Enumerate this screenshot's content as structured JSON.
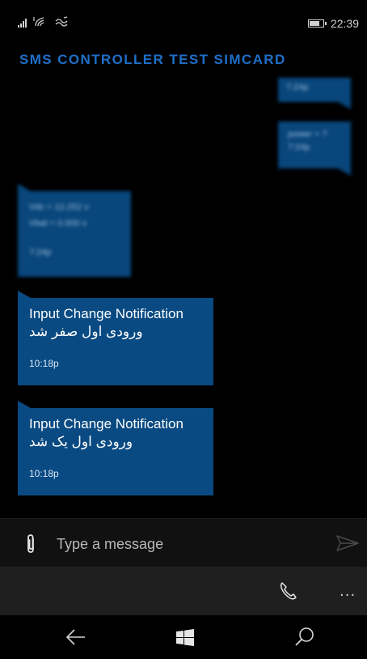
{
  "status_bar": {
    "time": "22:39",
    "signal_bars": 4,
    "battery_level": 0.75
  },
  "header": {
    "title": "SMS CONTROLLER TEST SIMCARD"
  },
  "messages": [
    {
      "direction": "outgoing",
      "lines": [
        "...",
        ""
      ],
      "time": "7:24p",
      "blurred": true
    },
    {
      "direction": "outgoing",
      "lines": [
        "power = ?"
      ],
      "time": "7:24p",
      "blurred": true
    },
    {
      "direction": "incoming",
      "lines": [
        "Vdc = 12.252 v",
        "Vbat = 0.000 v"
      ],
      "time": "7:24p",
      "blurred": true
    },
    {
      "direction": "incoming",
      "lines": [
        "Input Change Notification",
        "ورودی اول صفر شد"
      ],
      "time": "10:18p",
      "blurred": false
    },
    {
      "direction": "incoming",
      "lines": [
        "Input Change Notification",
        "ورودی اول یک شد"
      ],
      "time": "10:18p",
      "blurred": false
    }
  ],
  "composer": {
    "placeholder": "Type a message"
  },
  "app_bar": {
    "more_label": "..."
  },
  "colors": {
    "accent": "#1f6fc8",
    "bubble": "#094a82",
    "background": "#000000"
  },
  "icons": {
    "attach": "paperclip-icon",
    "send": "send-icon",
    "call": "phone-icon",
    "back": "back-arrow-icon",
    "start": "windows-logo-icon",
    "search": "search-icon"
  }
}
